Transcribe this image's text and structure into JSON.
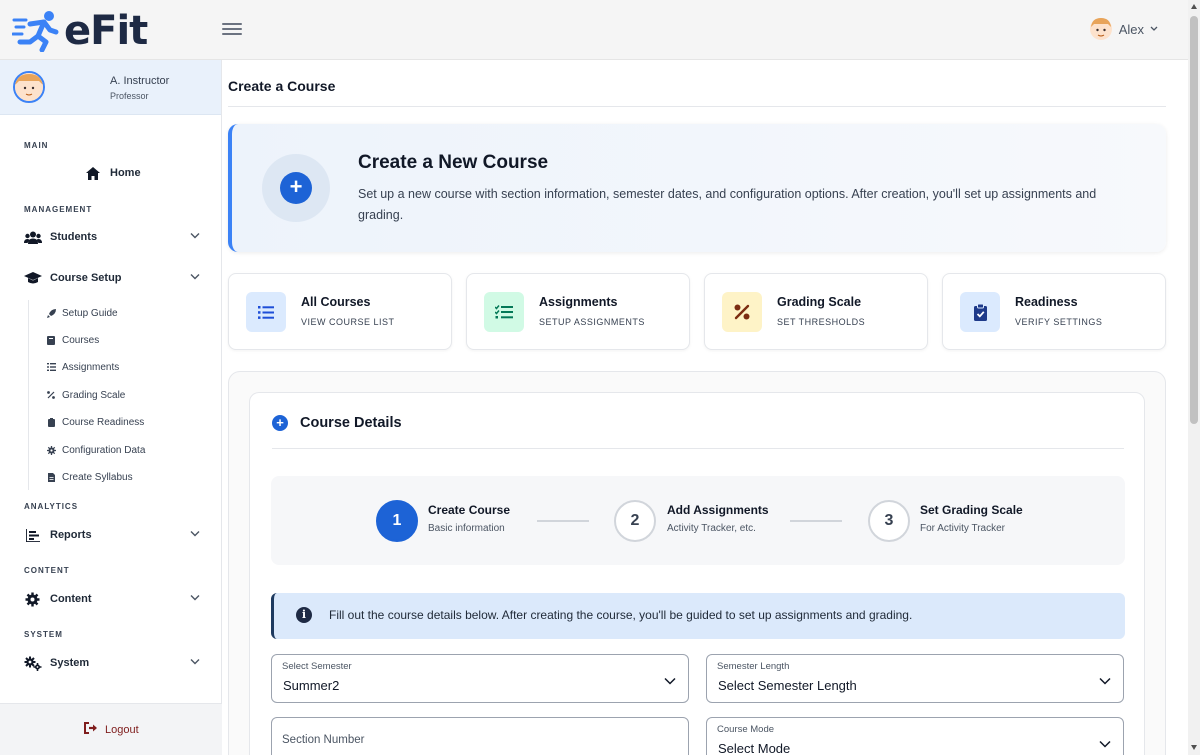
{
  "app": {
    "logo_text": "eFit"
  },
  "header": {
    "user_name": "Alex"
  },
  "sidebar": {
    "profile": {
      "name": "A. Instructor",
      "role": "Professor"
    },
    "sections": {
      "main": "MAIN",
      "management": "MANAGEMENT",
      "analytics": "ANALYTICS",
      "content": "CONTENT",
      "system": "SYSTEM"
    },
    "items": {
      "home": "Home",
      "students": "Students",
      "course_setup": "Course Setup",
      "reports": "Reports",
      "content": "Content",
      "system": "System"
    },
    "sub_items": [
      "Setup Guide",
      "Courses",
      "Assignments",
      "Grading Scale",
      "Course Readiness",
      "Configuration Data",
      "Create Syllabus"
    ],
    "logout": "Logout"
  },
  "page": {
    "title": "Create a Course"
  },
  "hero": {
    "title": "Create a New Course",
    "description": "Set up a new course with section information, semester dates, and configuration options. After creation, you'll set up assignments and grading."
  },
  "quick_links": [
    {
      "title": "All Courses",
      "subtitle": "VIEW COURSE LIST",
      "icon": "list-icon",
      "bg": "#dbeafe",
      "fg": "#1d4ed8"
    },
    {
      "title": "Assignments",
      "subtitle": "SETUP ASSIGNMENTS",
      "icon": "checklist-icon",
      "bg": "#d1fae5",
      "fg": "#047857"
    },
    {
      "title": "Grading Scale",
      "subtitle": "SET THRESHOLDS",
      "icon": "percent-icon",
      "bg": "#fef3c7",
      "fg": "#7c2d12"
    },
    {
      "title": "Readiness",
      "subtitle": "VERIFY SETTINGS",
      "icon": "clipboard-check-icon",
      "bg": "#dbeafe",
      "fg": "#1e3a8a"
    }
  ],
  "details": {
    "heading": "Course Details",
    "steps": [
      {
        "number": "1",
        "title": "Create Course",
        "subtitle": "Basic information"
      },
      {
        "number": "2",
        "title": "Add Assignments",
        "subtitle": "Activity Tracker, etc."
      },
      {
        "number": "3",
        "title": "Set Grading Scale",
        "subtitle": "For Activity Tracker"
      }
    ],
    "info": "Fill out the course details below. After creating the course, you'll be guided to set up assignments and grading.",
    "fields": {
      "semester": {
        "label": "Select Semester",
        "value": "Summer2"
      },
      "semester_length": {
        "label": "Semester Length",
        "value": "Select Semester Length"
      },
      "section_number": {
        "placeholder": "Section Number"
      },
      "course_mode": {
        "label": "Course Mode",
        "value": "Select Mode"
      }
    }
  },
  "colors": {
    "accent": "#1d63d6",
    "logo_blue": "#3b82f6",
    "logo_dark": "#1e2a44",
    "logout": "#7f1d1d"
  }
}
